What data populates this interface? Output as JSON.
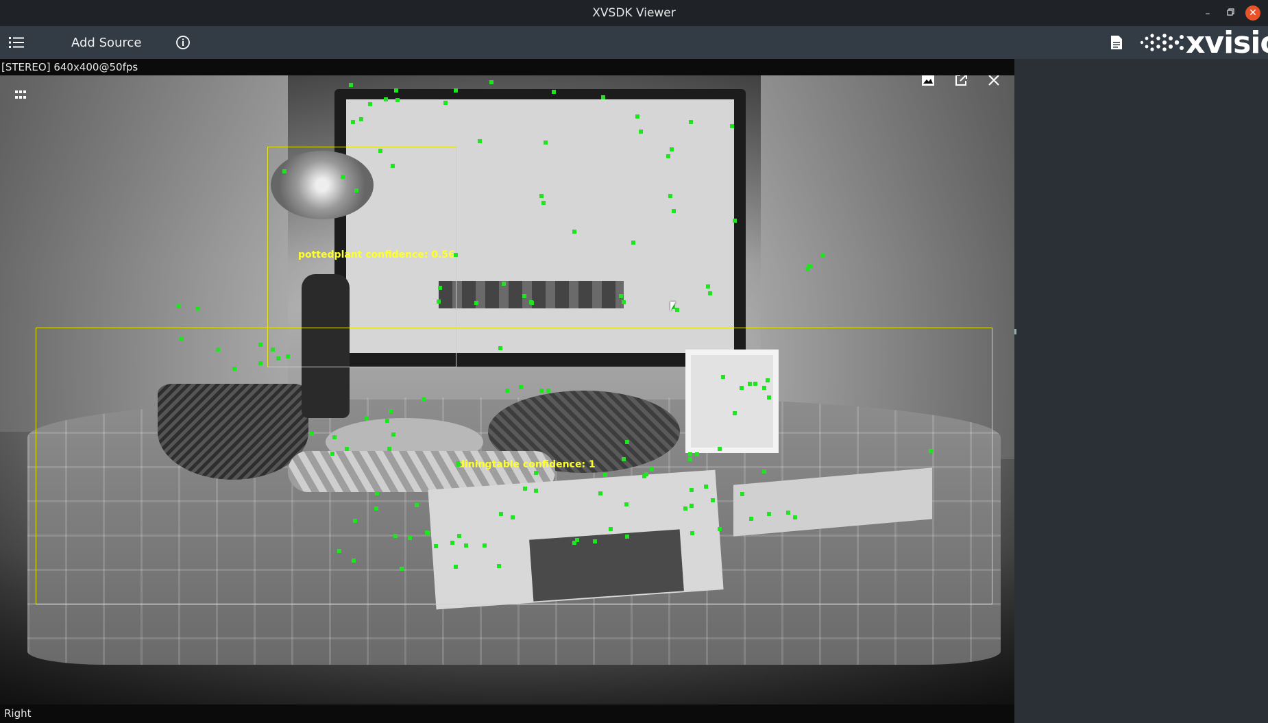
{
  "window": {
    "title": "XVSDK Viewer",
    "controls": {
      "minimize": "–",
      "restore": "▫",
      "close": "✕"
    }
  },
  "toolbar": {
    "menu_icon": "list-icon",
    "add_source_label": "Add Source",
    "info_icon": "info-icon",
    "document_icon": "document-icon",
    "logo_text": "xvisio"
  },
  "viewer": {
    "stream_info": "[STEREO]  640x400@50fps",
    "camera_side": "Right",
    "overlay_icons": [
      "grid-icon",
      "image-icon",
      "external-link-icon",
      "close-icon"
    ]
  },
  "detections": [
    {
      "label": "pottedplant confidence: 0.56",
      "color": "#e6e61a"
    },
    {
      "label": "diningtable confidence: 1",
      "color": "#e6e61a"
    }
  ],
  "colors": {
    "titlebar": "#1f2328",
    "toolbar": "#333b45",
    "close_button": "#e9532a",
    "keypoint": "#22e322",
    "detection": "#e6e61a"
  }
}
